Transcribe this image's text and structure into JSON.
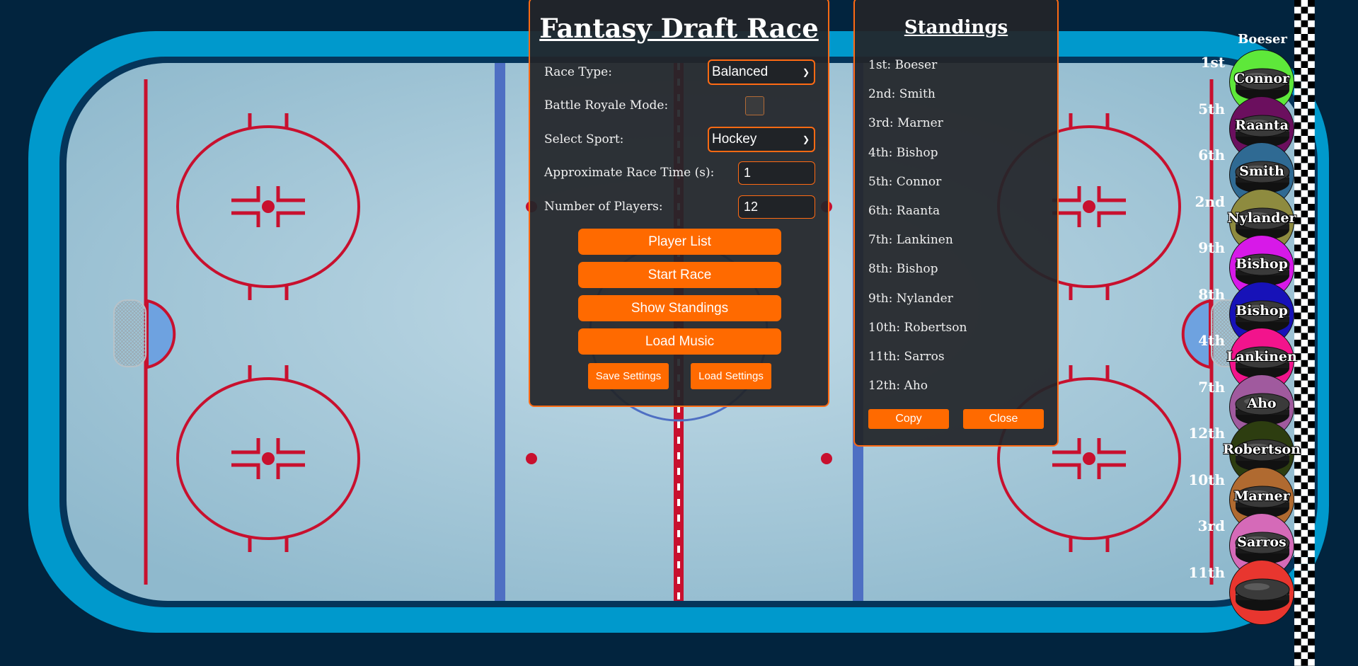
{
  "app": {
    "title": "Fantasy Draft Race"
  },
  "controls": {
    "race_type_label": "Race Type:",
    "race_type_value": "Balanced",
    "battle_royale_label": "Battle Royale Mode:",
    "battle_royale_checked": false,
    "sport_label": "Select Sport:",
    "sport_value": "Hockey",
    "race_time_label": "Approximate Race Time (s):",
    "race_time_value": "1",
    "players_label": "Number of Players:",
    "players_value": "12",
    "player_list_btn": "Player List",
    "start_race_btn": "Start Race",
    "show_standings_btn": "Show Standings",
    "load_music_btn": "Load Music",
    "save_settings_btn": "Save Settings",
    "load_settings_btn": "Load Settings"
  },
  "standings": {
    "title": "Standings",
    "items": [
      "1st: Boeser",
      "2nd: Smith",
      "3rd: Marner",
      "4th: Bishop",
      "5th: Connor",
      "6th: Raanta",
      "7th: Lankinen",
      "8th: Bishop",
      "9th: Nylander",
      "10th: Robertson",
      "11th: Sarros",
      "12th: Aho"
    ],
    "copy_btn": "Copy",
    "close_btn": "Close"
  },
  "track": {
    "leader_name": "Boeser",
    "racers": [
      {
        "place": "1st",
        "name": "Connor",
        "color": "#5ee83a"
      },
      {
        "place": "5th",
        "name": "Raanta",
        "color": "#6b0f5e"
      },
      {
        "place": "6th",
        "name": "Smith",
        "color": "#2f6a93"
      },
      {
        "place": "2nd",
        "name": "Nylander",
        "color": "#8e8b3f"
      },
      {
        "place": "9th",
        "name": "Bishop",
        "color": "#d719e8"
      },
      {
        "place": "8th",
        "name": "Bishop",
        "color": "#1712b8"
      },
      {
        "place": "4th",
        "name": "Lankinen",
        "color": "#f2148c"
      },
      {
        "place": "7th",
        "name": "Aho",
        "color": "#a05a9e"
      },
      {
        "place": "12th",
        "name": "Robertson",
        "color": "#2d3d10"
      },
      {
        "place": "10th",
        "name": "Marner",
        "color": "#b06a30"
      },
      {
        "place": "3rd",
        "name": "Sarros",
        "color": "#d56ab8"
      },
      {
        "place": "11th",
        "name": "",
        "color": "#e8362f"
      }
    ]
  },
  "colors": {
    "accent": "#ff6a00",
    "background": "#02243e",
    "ice": "#b8d4e2",
    "rink_border": "#0099cc"
  }
}
